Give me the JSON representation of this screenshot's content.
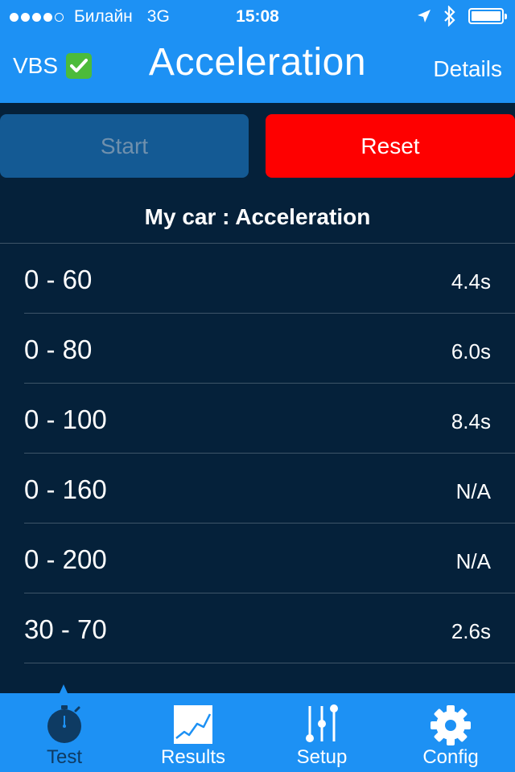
{
  "status_bar": {
    "carrier": "Билайн",
    "network": "3G",
    "time": "15:08"
  },
  "nav": {
    "left_label": "VBS",
    "title": "Acceleration",
    "right_label": "Details"
  },
  "buttons": {
    "start_label": "Start",
    "reset_label": "Reset"
  },
  "section_title": "My car : Acceleration",
  "results": [
    {
      "label": "0 - 60",
      "value": "4.4s"
    },
    {
      "label": "0 - 80",
      "value": "6.0s"
    },
    {
      "label": "0 - 100",
      "value": "8.4s"
    },
    {
      "label": "0 - 160",
      "value": "N/A"
    },
    {
      "label": "0 - 200",
      "value": "N/A"
    },
    {
      "label": "30 - 70",
      "value": "2.6s"
    }
  ],
  "tabs": [
    {
      "label": "Test",
      "icon": "stopwatch-icon",
      "active": true
    },
    {
      "label": "Results",
      "icon": "chart-icon",
      "active": false
    },
    {
      "label": "Setup",
      "icon": "sliders-icon",
      "active": false
    },
    {
      "label": "Config",
      "icon": "gear-icon",
      "active": false
    }
  ],
  "colors": {
    "accent": "#1d91f4",
    "background": "#05213a",
    "reset": "#fe0000",
    "start_disabled": "#145a94",
    "check": "#4cbb3a"
  }
}
